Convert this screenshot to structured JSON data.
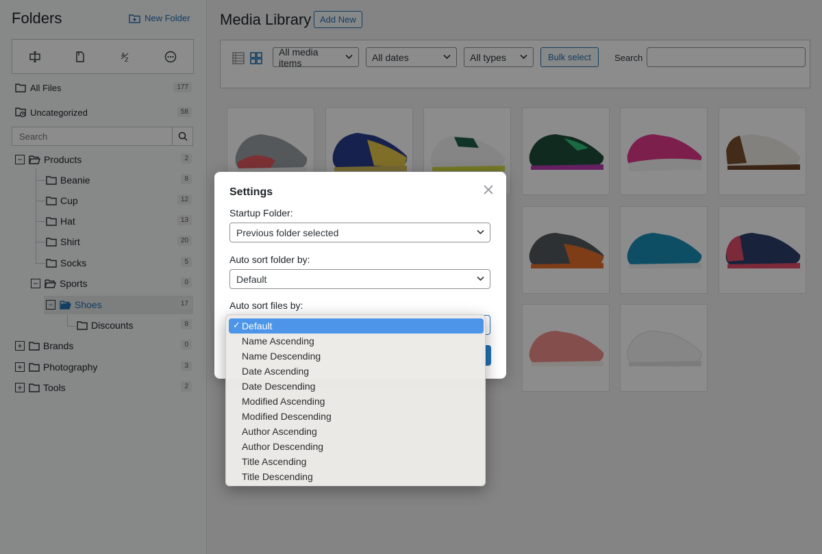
{
  "sidebar": {
    "title": "Folders",
    "new_folder_label": "New Folder",
    "all_files": {
      "label": "All Files",
      "count": "177"
    },
    "uncategorized": {
      "label": "Uncategorized",
      "count": "58"
    },
    "search_placeholder": "Search",
    "tree": [
      {
        "label": "Products",
        "count": "2"
      },
      {
        "label": "Beanie",
        "count": "8"
      },
      {
        "label": "Cup",
        "count": "12"
      },
      {
        "label": "Hat",
        "count": "13"
      },
      {
        "label": "Shirt",
        "count": "20"
      },
      {
        "label": "Socks",
        "count": "5"
      },
      {
        "label": "Sports",
        "count": "0"
      },
      {
        "label": "Shoes",
        "count": "17"
      },
      {
        "label": "Discounts",
        "count": "8"
      },
      {
        "label": "Brands",
        "count": "0"
      },
      {
        "label": "Photography",
        "count": "3"
      },
      {
        "label": "Tools",
        "count": "2"
      }
    ]
  },
  "main": {
    "title": "Media Library",
    "add_new_label": "Add New",
    "filters": {
      "media_items": "All media items",
      "dates": "All dates",
      "types": "All types",
      "bulk_select": "Bulk select",
      "search_label": "Search"
    },
    "thumbnails": [
      "gray-red-shoe",
      "navy-yellow-shoe",
      "white-green-shoe",
      "green-black-shoe",
      "pink-white-shoe",
      "white-brown-shoe",
      "gray-orange-shoe",
      "teal-blue-shoe",
      "navy-pink-shoe",
      "salmon-pink-shoe",
      "white-shoe"
    ]
  },
  "modal": {
    "title": "Settings",
    "startup_folder_label": "Startup Folder:",
    "startup_folder_value": "Previous folder selected",
    "auto_sort_folder_label": "Auto sort folder by:",
    "auto_sort_folder_value": "Default",
    "auto_sort_files_label": "Auto sort files by:"
  },
  "dropdown": {
    "options": [
      "Default",
      "Name Ascending",
      "Name Descending",
      "Date Ascending",
      "Date Descending",
      "Modified Ascending",
      "Modified Descending",
      "Author Ascending",
      "Author Descending",
      "Title Ascending",
      "Title Descending"
    ],
    "selected_index": 0
  },
  "colors": {
    "accent": "#2271b1",
    "highlight": "#4c95e8"
  }
}
